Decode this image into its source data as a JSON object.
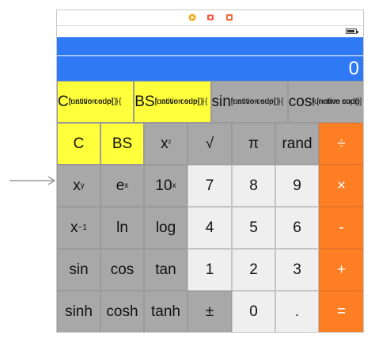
{
  "colors": {
    "display": "#3079f4",
    "yellow": "#ffff3b",
    "gray": "#a8a8a8",
    "light": "#efefef",
    "orange": "#fe7e24"
  },
  "scene_dock": {
    "icons": [
      "view-controller-icon",
      "first-responder-icon",
      "exit-icon"
    ]
  },
  "display": {
    "value": "0"
  },
  "top_row": [
    "C",
    "BS",
    "sin",
    "cos"
  ],
  "grid_rows": [
    [
      {
        "label": "C"
      },
      {
        "label": "BS"
      },
      {
        "label": "x",
        "sup": "²"
      },
      {
        "label": "√"
      },
      {
        "label": "π"
      },
      {
        "label": "rand"
      },
      {
        "label": "÷"
      }
    ],
    [
      {
        "label": "x",
        "sup": "y"
      },
      {
        "label": "e",
        "sup": "x"
      },
      {
        "label": "10",
        "sup": "x"
      },
      {
        "label": "7"
      },
      {
        "label": "8"
      },
      {
        "label": "9"
      },
      {
        "label": "×"
      }
    ],
    [
      {
        "label": "x",
        "sup": "−1"
      },
      {
        "label": "ln"
      },
      {
        "label": "log"
      },
      {
        "label": "4"
      },
      {
        "label": "5"
      },
      {
        "label": "6"
      },
      {
        "label": "-"
      }
    ],
    [
      {
        "label": "sin"
      },
      {
        "label": "cos"
      },
      {
        "label": "tan"
      },
      {
        "label": "1"
      },
      {
        "label": "2"
      },
      {
        "label": "3"
      },
      {
        "label": "+"
      }
    ],
    [
      {
        "label": "sinh"
      },
      {
        "label": "cosh"
      },
      {
        "label": "tanh"
      },
      {
        "label": "±"
      },
      {
        "label": "0"
      },
      {
        "label": "."
      },
      {
        "label": "="
      }
    ]
  ]
}
